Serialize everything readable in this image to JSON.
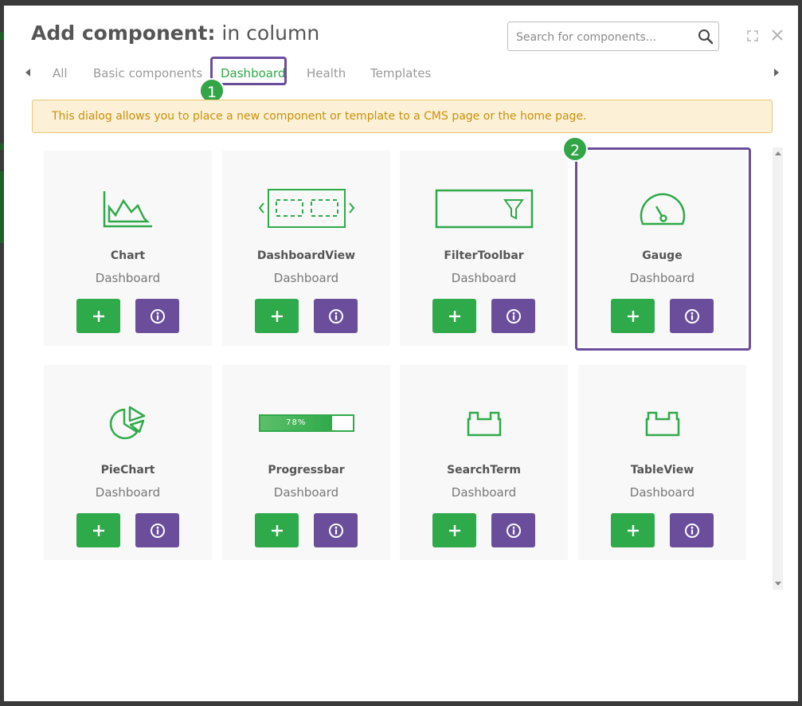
{
  "dialog": {
    "title_bold": "Add component:",
    "title_rest": " in column"
  },
  "search": {
    "placeholder": "Search for components..."
  },
  "tabs": [
    {
      "label": "All",
      "active": false
    },
    {
      "label": "Basic components",
      "active": false
    },
    {
      "label": "Dashboard",
      "active": true
    },
    {
      "label": "Health",
      "active": false
    },
    {
      "label": "Templates",
      "active": false
    }
  ],
  "badges": {
    "tab": "1",
    "card": "2"
  },
  "info_banner": "This dialog allows you to place a new component or template to a CMS page or the home page.",
  "components": [
    {
      "name": "Chart",
      "category": "Dashboard",
      "icon": "area-chart-icon"
    },
    {
      "name": "DashboardView",
      "category": "Dashboard",
      "icon": "dashboard-view-icon"
    },
    {
      "name": "FilterToolbar",
      "category": "Dashboard",
      "icon": "filter-toolbar-icon"
    },
    {
      "name": "Gauge",
      "category": "Dashboard",
      "icon": "gauge-icon"
    },
    {
      "name": "PieChart",
      "category": "Dashboard",
      "icon": "pie-chart-icon"
    },
    {
      "name": "Progressbar",
      "category": "Dashboard",
      "icon": "progressbar-icon",
      "icon_text": "78%",
      "progress": 0.78
    },
    {
      "name": "SearchTerm",
      "category": "Dashboard",
      "icon": "block-icon"
    },
    {
      "name": "TableView",
      "category": "Dashboard",
      "icon": "block-icon"
    }
  ],
  "colors": {
    "accent": "#2faa4a",
    "info_button": "#6b4e9b",
    "highlight": "#6b4e9b",
    "banner_text": "#c9900c"
  }
}
